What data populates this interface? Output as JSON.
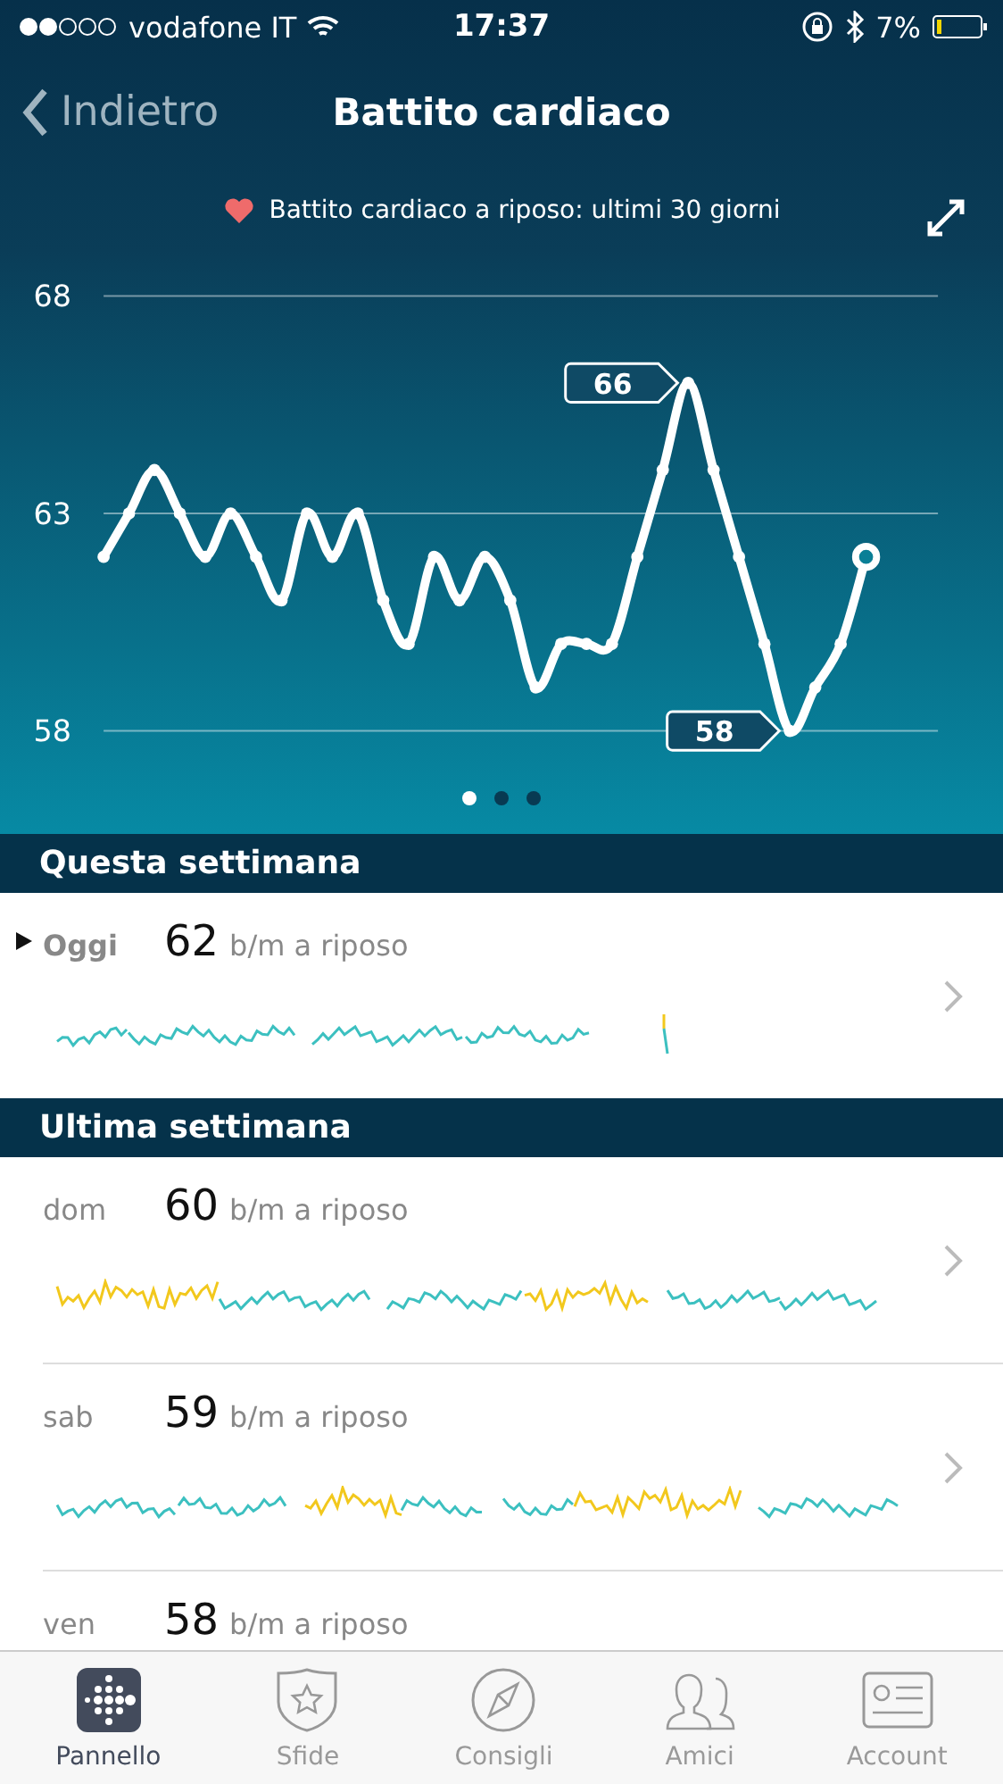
{
  "status_bar": {
    "carrier": "vodafone IT",
    "time": "17:37",
    "battery": "7%"
  },
  "nav": {
    "back": "Indietro",
    "title": "Battito cardiaco"
  },
  "chart_panel": {
    "heading": "Battito cardiaco a riposo: ultimi 30 giorni",
    "chart_data": {
      "type": "line",
      "series": [
        {
          "color": "#ffffff",
          "marker": true,
          "values": [
            62,
            63,
            64,
            63,
            62,
            63,
            62,
            61,
            63,
            62,
            63,
            61,
            60,
            62,
            61,
            62,
            61,
            59,
            60,
            60,
            60,
            62,
            64,
            66,
            64,
            62,
            60,
            58,
            59,
            60,
            62
          ]
        }
      ],
      "ylim": [
        58,
        68
      ],
      "yticks": [
        58,
        63,
        68
      ]
    },
    "callouts": [
      "66",
      "58"
    ],
    "pages": [
      {
        "selected": true
      },
      {
        "selected": false
      },
      {
        "selected": false
      }
    ]
  },
  "sections": [
    {
      "title": "Questa settimana",
      "rows": [
        {
          "day": "Oggi",
          "today": true,
          "value": "62",
          "unit": "b/m a riposo"
        }
      ]
    },
    {
      "title": "Ultima settimana",
      "rows": [
        {
          "day": "dom",
          "today": false,
          "value": "60",
          "unit": "b/m a riposo"
        },
        {
          "day": "sab",
          "today": false,
          "value": "59",
          "unit": "b/m a riposo"
        },
        {
          "day": "ven",
          "today": false,
          "value": "58",
          "unit": "b/m a riposo"
        }
      ]
    }
  ],
  "tab_bar": [
    {
      "label": "Pannello",
      "selected": true
    },
    {
      "label": "Sfide",
      "selected": false
    },
    {
      "label": "Consigli",
      "selected": false
    },
    {
      "label": "Amici",
      "selected": false
    },
    {
      "label": "Account",
      "selected": false
    }
  ]
}
